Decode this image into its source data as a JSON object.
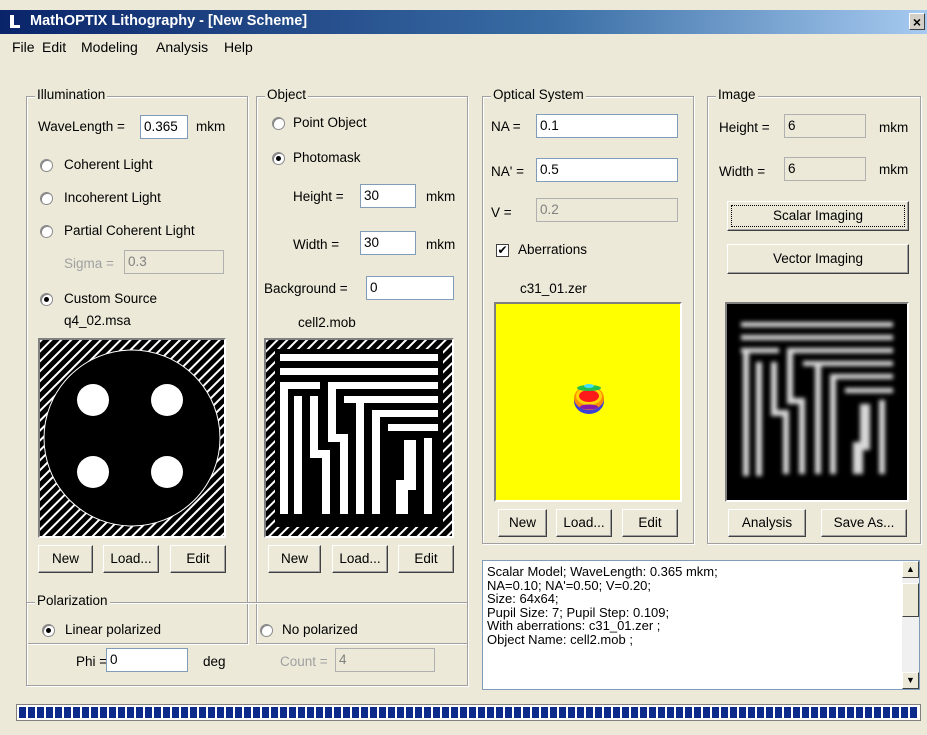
{
  "window": {
    "title": "MathOPTIX Lithography - [New Scheme]",
    "close_label": "×"
  },
  "menu": [
    "File",
    "Edit",
    "Modeling",
    "Analysis",
    "Help"
  ],
  "illumination": {
    "legend": "Illumination",
    "wavelength_label": "WaveLength =",
    "wavelength_value": "0.365",
    "wavelength_unit": "mkm",
    "options": [
      "Coherent Light",
      "Incoherent Light",
      "Partial Coherent Light",
      "Custom Source"
    ],
    "selected": "Custom Source",
    "sigma_label": "Sigma =",
    "sigma_value": "0.3",
    "source_file": "q4_02.msa",
    "buttons": [
      "New",
      "Load...",
      "Edit"
    ]
  },
  "object": {
    "legend": "Object",
    "options": [
      "Point Object",
      "Photomask"
    ],
    "selected": "Photomask",
    "height_label": "Height =",
    "height_value": "30",
    "width_label": "Width =",
    "width_value": "30",
    "unit": "mkm",
    "background_label": "Background =",
    "background_value": "0",
    "file": "cell2.mob",
    "buttons": [
      "New",
      "Load...",
      "Edit"
    ]
  },
  "optical": {
    "legend": "Optical System",
    "na_label": "NA =",
    "na_value": "0.1",
    "na2_label": "NA' =",
    "na2_value": "0.5",
    "v_label": "V =",
    "v_value": "0.2",
    "aberrations_label": "Aberrations",
    "aberrations_checked": true,
    "check_mark": "✔",
    "file": "c31_01.zer",
    "buttons": [
      "New",
      "Load...",
      "Edit"
    ]
  },
  "image": {
    "legend": "Image",
    "height_label": "Height =",
    "height_value": "6",
    "width_label": "Width =",
    "width_value": "6",
    "unit": "mkm",
    "scalar_button": "Scalar Imaging",
    "vector_button": "Vector Imaging",
    "buttons": [
      "Analysis",
      "Save As..."
    ]
  },
  "polarization": {
    "legend": "Polarization",
    "linear_label": "Linear polarized",
    "none_label": "No polarized",
    "selected": "Linear polarized",
    "phi_label": "Phi =",
    "phi_value": "0",
    "phi_unit": "deg",
    "count_label": "Count =",
    "count_value": "4"
  },
  "log": [
    "Scalar Model; WaveLength: 0.365 mkm;",
    " NA=0.10; NA'=0.50; V=0.20;",
    "Size: 64x64;",
    "Pupil Size: 7; Pupil Step:  0.109;",
    "With aberrations: c31_01.zer ;",
    "Object Name: cell2.mob ;"
  ],
  "scroll_icons": {
    "up": "▲",
    "down": "▼"
  },
  "colors": {
    "title_start": "#0a246a",
    "title_end": "#a6caf0",
    "face": "#ece9d8",
    "pupil_bg": "#ffff00",
    "progress": "#0b2a8a"
  },
  "progress": {
    "fraction": 1.0
  }
}
